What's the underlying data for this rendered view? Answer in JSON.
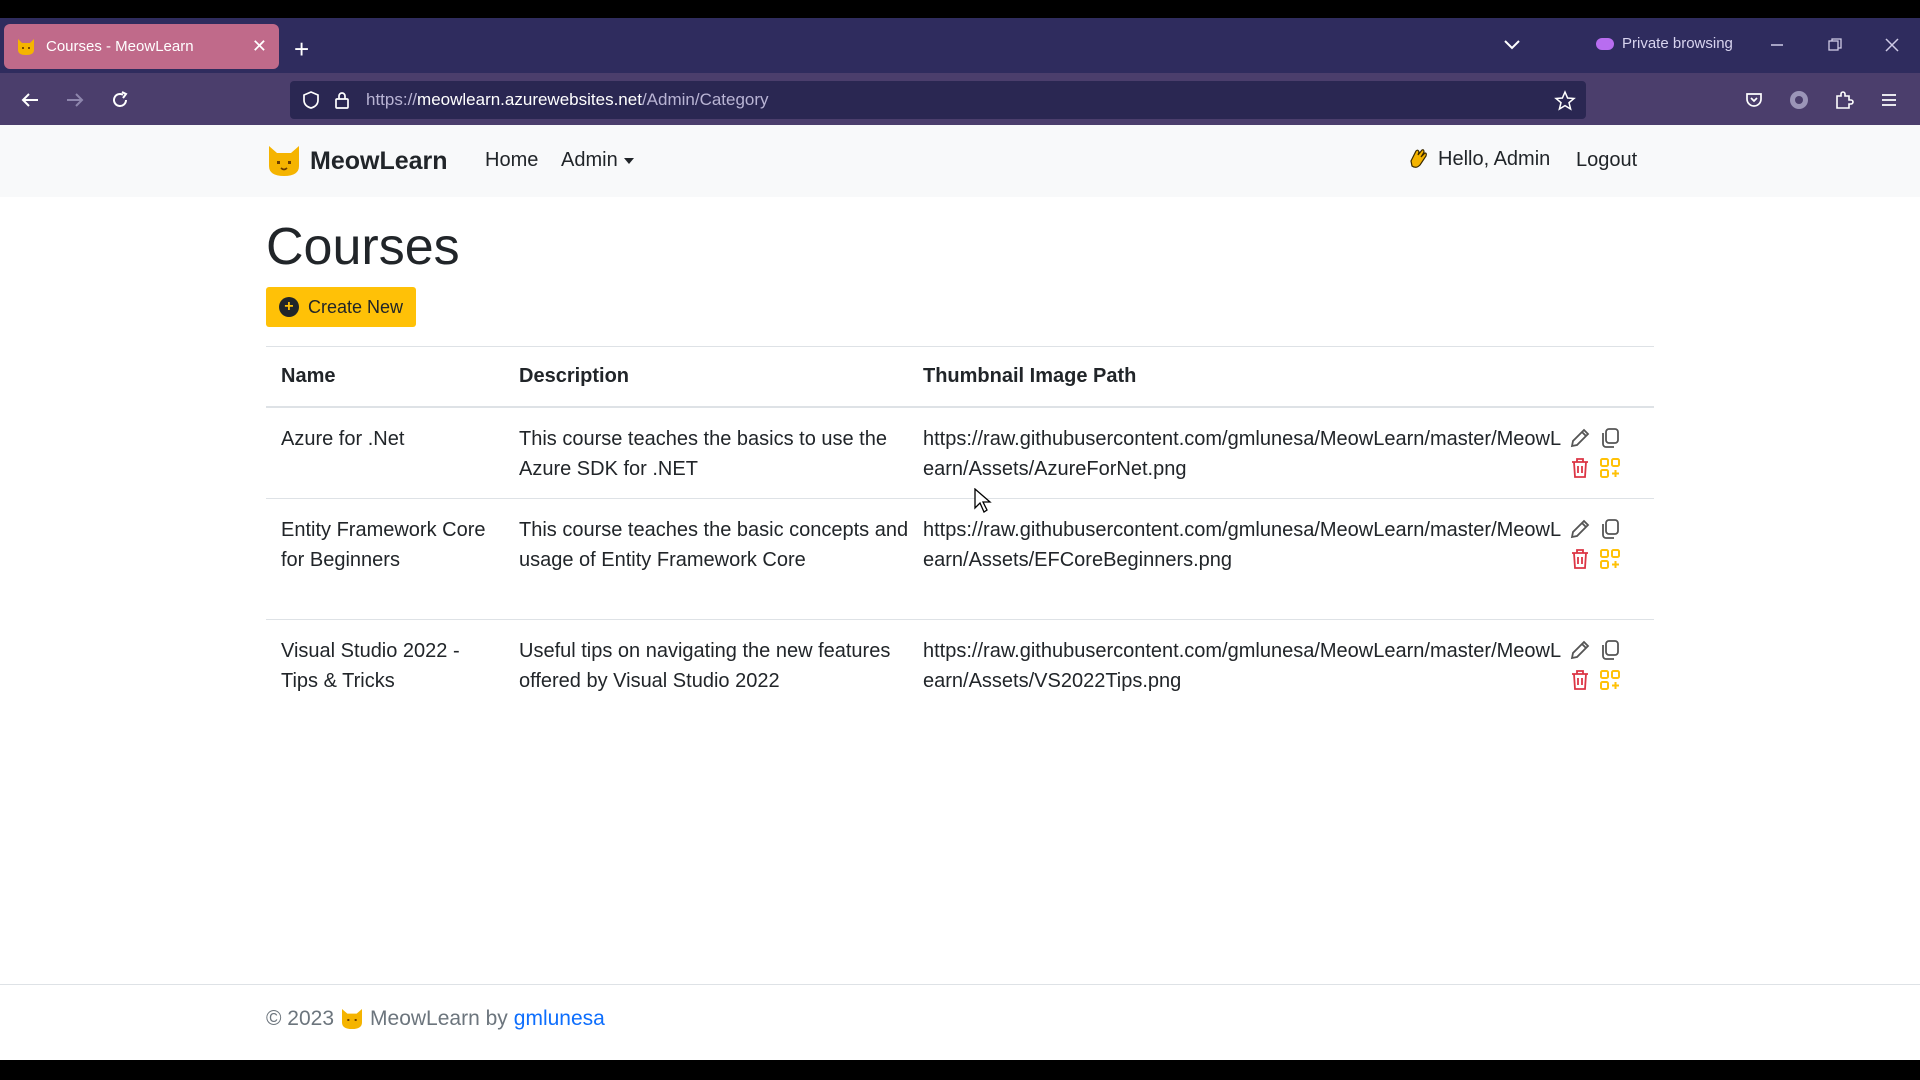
{
  "browser": {
    "tab_title": "Courses - MeowLearn",
    "tab_close": "✕",
    "new_tab": "+",
    "private_label": "Private browsing",
    "url_prefix": "https://",
    "url_host": "meowlearn.azurewebsites.net",
    "url_path": "/Admin/Category"
  },
  "site": {
    "brand": "MeowLearn",
    "nav": {
      "home": "Home",
      "admin": "Admin"
    },
    "greeting": "Hello, Admin",
    "logout": "Logout"
  },
  "main": {
    "title": "Courses",
    "create_label": "Create New",
    "columns": [
      "Name",
      "Description",
      "Thumbnail Image Path"
    ],
    "rows": [
      {
        "name": "Azure for .Net",
        "description": "This course teaches the basics to use the Azure SDK for .NET",
        "path": "https://raw.githubusercontent.com/gmlunesa/MeowLearn/master/MeowLearn/Assets/AzureForNet.png"
      },
      {
        "name": "Entity Framework Core for Beginners",
        "description": "This course teaches the basic concepts and usage of Entity Framework Core",
        "path": "https://raw.githubusercontent.com/gmlunesa/MeowLearn/master/MeowLearn/Assets/EFCoreBeginners.png"
      },
      {
        "name": "Visual Studio 2022 - Tips & Tricks",
        "description": "Useful tips on navigating the new features offered by Visual Studio 2022",
        "path": "https://raw.githubusercontent.com/gmlunesa/MeowLearn/master/MeowLearn/Assets/VS2022Tips.png"
      }
    ],
    "row_icons": [
      "pencil-icon",
      "copy-icon",
      "trash-icon",
      "grid-add-icon"
    ]
  },
  "footer": {
    "copyright": "© 2023",
    "brand_text": "MeowLearn by",
    "author": "gmlunesa"
  },
  "colors": {
    "accent": "#ffc107",
    "danger": "#dc3545",
    "link": "#0d6efd",
    "tab": "#c06a8a",
    "chrome": "#2f2c5e"
  }
}
